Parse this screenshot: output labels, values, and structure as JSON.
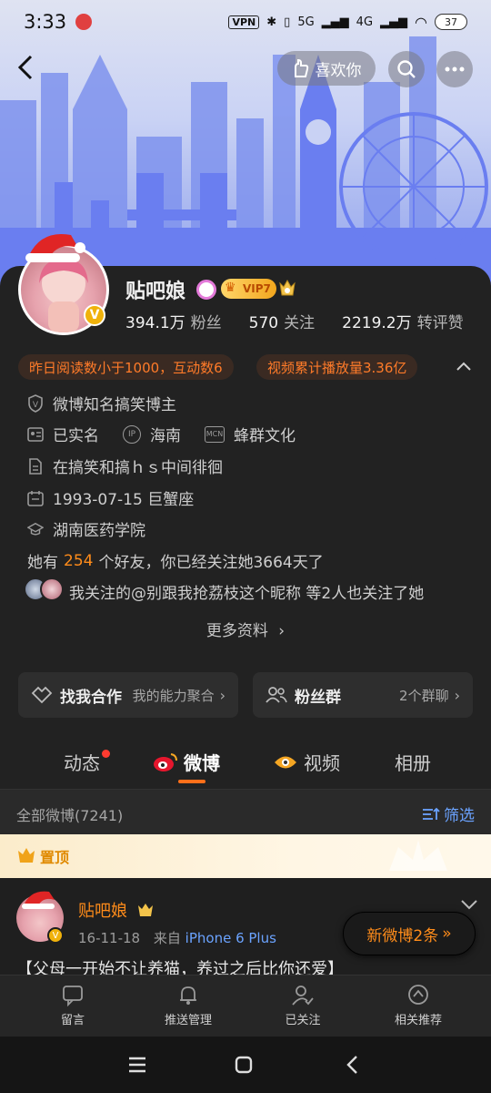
{
  "status_bar": {
    "time": "3:33",
    "vpn": "VPN",
    "net1": "5G",
    "net2": "4G",
    "battery": "37"
  },
  "top_nav": {
    "like_label": "喜欢你"
  },
  "profile": {
    "name": "贴吧娘",
    "vip_label": "VIP7",
    "stats": [
      {
        "num": "394.1万",
        "label": "粉丝"
      },
      {
        "num": "570",
        "label": "关注"
      },
      {
        "num": "2219.2万",
        "label": "转评赞"
      }
    ],
    "tags": [
      "昨日阅读数小于1000，互动数6",
      "视频累计播放量3.36亿"
    ],
    "info": {
      "role": "微博知名搞笑博主",
      "realname": "已实名",
      "ip_badge": "IP",
      "location": "海南",
      "mcn_badge": "MCN",
      "mcn": "蜂群文化",
      "bio": "在搞笑和搞ｈｓ中间徘徊",
      "birthday": "1993-07-15 巨蟹座",
      "school": "湖南医药学院",
      "friends_prefix": "她有",
      "friends_count": "254",
      "friends_suffix": "个好友，你已经关注她3664天了",
      "mutual": "我关注的@别跟我抢荔枝这个昵称 等2人也关注了她"
    },
    "more_label": "更多资料"
  },
  "cards": [
    {
      "title": "找我合作",
      "sub": "我的能力聚合"
    },
    {
      "title": "粉丝群",
      "sub": "2个群聊"
    }
  ],
  "tabs": [
    {
      "label": "动态"
    },
    {
      "label": "微博"
    },
    {
      "label": "视频"
    },
    {
      "label": "相册"
    }
  ],
  "filter": {
    "all_label": "全部微博(7241)",
    "filter_label": "筛选"
  },
  "pinned_label": "置顶",
  "post": {
    "author": "贴吧娘",
    "date": "16-11-18",
    "from": "来自",
    "device": "iPhone 6 Plus",
    "text": "【父母一开始不让养猫，养过之后比你还爱】"
  },
  "new_post_label": "新微博2条",
  "bottom_bar": [
    {
      "label": "留言",
      "icon": "message-icon"
    },
    {
      "label": "推送管理",
      "icon": "bell-icon"
    },
    {
      "label": "已关注",
      "icon": "user-check-icon"
    },
    {
      "label": "相关推荐",
      "icon": "recommend-icon"
    }
  ],
  "colors": {
    "accent": "#ff8c1a",
    "link": "#6ba3ff",
    "background": "#1e1e1e",
    "banner": "#8d9ff0"
  }
}
